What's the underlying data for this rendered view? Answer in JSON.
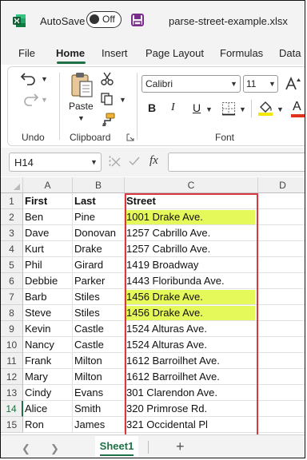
{
  "titlebar": {
    "autosave_label": "AutoSave",
    "toggle_state": "Off",
    "filename": "parse-street-example.xlsx",
    "colors": {
      "excel_green": "#1e7145",
      "save_purple": "#7b2c8c"
    }
  },
  "menu": {
    "tabs": [
      "File",
      "Home",
      "Insert",
      "Page Layout",
      "Formulas",
      "Data"
    ],
    "active": "Home"
  },
  "ribbon": {
    "groups": {
      "undo": "Undo",
      "clipboard": "Clipboard",
      "font": "Font"
    },
    "paste_label": "Paste",
    "font_name": "Calibri",
    "font_size": "11",
    "bold_label": "B",
    "italic_label": "I",
    "underline_label": "U",
    "font_color_label": "A",
    "highlight_color": "#f5e700",
    "font_color": "#e0301e"
  },
  "formula_bar": {
    "name_box": "H14",
    "fx_label": "fx",
    "formula": ""
  },
  "sheet": {
    "columns": [
      "A",
      "B",
      "C",
      "D"
    ],
    "rows": [
      {
        "num": "1",
        "first": "First",
        "last": "Last",
        "street": "Street"
      },
      {
        "num": "2",
        "first": "Ben",
        "last": "Pine",
        "street": "1001 Drake Ave."
      },
      {
        "num": "3",
        "first": "Dave",
        "last": "Donovan",
        "street": "1257 Cabrillo Ave."
      },
      {
        "num": "4",
        "first": "Kurt",
        "last": "Drake",
        "street": "1257 Cabrillo Ave."
      },
      {
        "num": "5",
        "first": "Phil",
        "last": "Girard",
        "street": "1419 Broadway"
      },
      {
        "num": "6",
        "first": "Debbie",
        "last": "Parker",
        "street": "1443 Floribunda Ave."
      },
      {
        "num": "7",
        "first": "Barb",
        "last": "Stiles",
        "street": "1456 Drake Ave."
      },
      {
        "num": "8",
        "first": "Steve",
        "last": "Stiles",
        "street": "1456 Drake Ave."
      },
      {
        "num": "9",
        "first": "Kevin",
        "last": "Castle",
        "street": "1524 Alturas Ave."
      },
      {
        "num": "10",
        "first": "Nancy",
        "last": "Castle",
        "street": "1524 Alturas Ave."
      },
      {
        "num": "11",
        "first": "Frank",
        "last": "Milton",
        "street": "1612 Barroilhet Ave."
      },
      {
        "num": "12",
        "first": "Mary",
        "last": "Milton",
        "street": "1612 Barroilhet Ave."
      },
      {
        "num": "13",
        "first": "Cindy",
        "last": "Evans",
        "street": "301 Clarendon Ave."
      },
      {
        "num": "14",
        "first": "Alice",
        "last": "Smith",
        "street": "320 Primrose Rd."
      },
      {
        "num": "15",
        "first": "Ron",
        "last": "James",
        "street": "321 Occidental Pl"
      }
    ],
    "highlighted_rows": [
      "2",
      "7",
      "8"
    ],
    "selected_row": "14",
    "highlight_color": "#e6f95b",
    "outline_color": "#d9383f"
  },
  "sheet_tabs": {
    "tabs": [
      "Sheet1"
    ],
    "active": "Sheet1",
    "add_label": "+"
  }
}
